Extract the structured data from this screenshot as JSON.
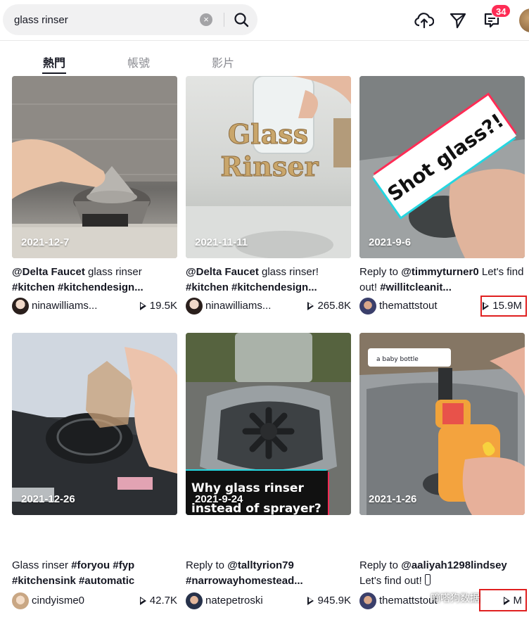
{
  "search": {
    "value": "glass rinser"
  },
  "notifications": {
    "count": "34"
  },
  "tabs": [
    {
      "label": "熱門"
    },
    {
      "label": "帳號"
    },
    {
      "label": "影片"
    }
  ],
  "videos": [
    {
      "date": "2021-12-7",
      "desc_mention": "@Delta Faucet",
      "desc_text": " glass rinser",
      "desc_tags": "#kitchen #kitchendesign...",
      "author": "ninawilliams...",
      "views": "19.5K"
    },
    {
      "date": "2021-11-11",
      "overlay": "Glass\nRinser",
      "desc_mention": "@Delta Faucet",
      "desc_text": " glass rinser!",
      "desc_tags": "#kitchen #kitchendesign...",
      "author": "ninawilliams...",
      "views": "265.8K"
    },
    {
      "date": "2021-9-6",
      "overlay": "Shot glass?!",
      "desc_prefix": "Reply to ",
      "desc_mention": "@timmyturner0",
      "desc_text": " Let's find out! ",
      "desc_tags": "#willitcleanit...",
      "author": "themattstout",
      "views": "15.9M"
    },
    {
      "date": "2021-12-26",
      "desc_prefix": "Glass rinser ",
      "desc_mention": "#foryou #fyp",
      "desc_tags": "#kitchensink #automatic",
      "author": "cindyisme0",
      "views": "42.7K"
    },
    {
      "date": "2021-9-24",
      "overlay": "Why glass rinser\ninstead of sprayer?",
      "desc_prefix": "Reply to ",
      "desc_mention": "@talltyrion79",
      "desc_tags": "#narrowayhomestead...",
      "author": "natepetroski",
      "views": "945.9K"
    },
    {
      "date": "2021-1-26",
      "overlay": "a baby bottle",
      "desc_prefix": "Reply to ",
      "desc_mention": "@aaliyah1298lindsey",
      "desc_text": "Let's find out! ",
      "author": "themattstout",
      "views": "M"
    }
  ],
  "watermark": "嘀嗒狗数据",
  "icons": [
    "search-icon",
    "clear-icon",
    "upload-icon",
    "send-icon",
    "inbox-icon",
    "play-icon"
  ],
  "colors": {
    "accent": "#fe2c55",
    "highlight": "#e02020",
    "text": "#161823",
    "muted": "#8a8b91"
  }
}
